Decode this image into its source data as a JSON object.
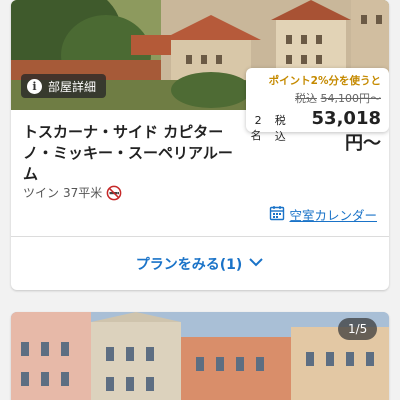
{
  "room_card": {
    "detail_badge": "部屋詳細",
    "price": {
      "points_promo": "ポイント2%分を使うと",
      "original_prefix": "税込",
      "original_price": "54,100円〜",
      "guests": "2名",
      "tax_label": "税込",
      "final_price": "53,018円〜"
    },
    "room_name": "トスカーナ・サイド カピターノ・ミッキー・スーペリアルーム",
    "room_type": "ツイン",
    "room_size": "37平米",
    "nonsmoking_icon": "no-smoking-icon",
    "calendar_link": "空室カレンダー",
    "plan_button": "プランをみる(1)"
  },
  "next_card": {
    "photo_counter": "1/5"
  },
  "colors": {
    "link_blue": "#1a73c8",
    "promo_gold": "#c58a00",
    "background": "#f2f2f2"
  }
}
